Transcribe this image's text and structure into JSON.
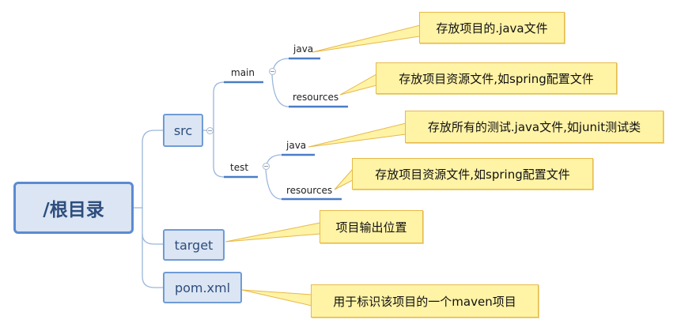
{
  "root": {
    "label": "/根目录"
  },
  "nodes": {
    "src": "src",
    "target": "target",
    "pom": "pom.xml"
  },
  "leaves": {
    "main": "main",
    "main_java": "java",
    "main_resources": "resources",
    "test": "test",
    "test_java": "java",
    "test_resources": "resources"
  },
  "notes": {
    "main_java": "存放项目的.java文件",
    "main_resources": "存放项目资源文件,如spring配置文件",
    "test_java": "存放所有的测试.java文件,如junit测试类",
    "test_resources": "存放项目资源文件,如spring配置文件",
    "target": "项目输出位置",
    "pom": "用于标识该项目的一个maven项目"
  },
  "colors": {
    "connector": "#5b8bd0",
    "callout_fill": "#fff3a6",
    "callout_border": "#e6b94a",
    "node_fill": "#dbe5f3"
  }
}
